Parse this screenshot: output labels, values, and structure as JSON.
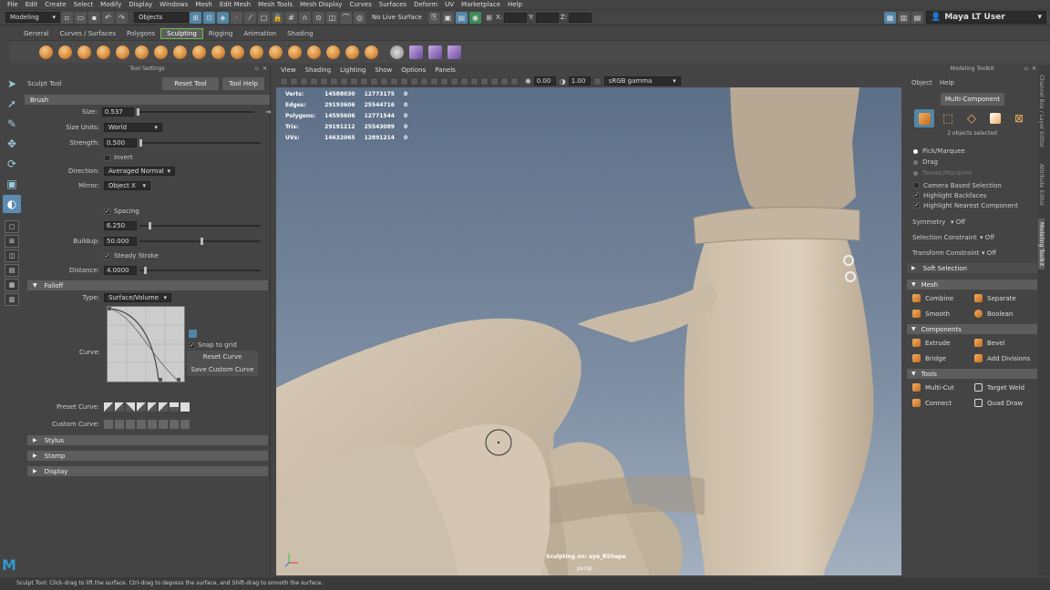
{
  "menubar": [
    "File",
    "Edit",
    "Create",
    "Select",
    "Modify",
    "Display",
    "Windows",
    "Mesh",
    "Edit Mesh",
    "Mesh Tools",
    "Mesh Display",
    "Curves",
    "Surfaces",
    "Deform",
    "UV",
    "Marketplace",
    "Help"
  ],
  "statusline": {
    "mode": "Modeling",
    "select_mode": "Objects",
    "live_surface": "No Live Surface",
    "x_label": "X:",
    "y_label": "Y:",
    "z_label": "Z:",
    "user": "Maya LT User"
  },
  "shelf": {
    "tabs": [
      "General",
      "Curves / Surfaces",
      "Polygons",
      "Sculpting",
      "Rigging",
      "Animation",
      "Shading"
    ],
    "active_tab": "Sculpting"
  },
  "tool_settings": {
    "header": "Tool Settings",
    "tool_name": "Sculpt Tool",
    "reset_tool": "Reset Tool",
    "tool_help": "Tool Help",
    "brush_section": "Brush",
    "size_label": "Size:",
    "size_value": "0.537",
    "size_units_label": "Size Units:",
    "size_units_value": "World",
    "strength_label": "Strength:",
    "strength_value": "0.500",
    "invert_label": "Invert",
    "direction_label": "Direction:",
    "direction_value": "Averaged Normal",
    "mirror_label": "Mirror:",
    "mirror_value": "Object X",
    "spacing_label": "Spacing",
    "spacing_value": "6.250",
    "buildup_label": "Buildup:",
    "buildup_value": "50.000",
    "steady_label": "Steady Stroke",
    "distance_label": "Distance:",
    "distance_value": "4.0000",
    "falloff_section": "Falloff",
    "type_label": "Type:",
    "type_value": "Surface/Volume",
    "curve_label": "Curve:",
    "snap_label": "Snap to grid",
    "reset_curve": "Reset Curve",
    "save_curve": "Save Custom Curve",
    "preset_curve_label": "Preset Curve:",
    "custom_curve_label": "Custom Curve:",
    "stylus_section": "Stylus",
    "stamp_section": "Stamp",
    "display_section": "Display"
  },
  "viewport": {
    "menu": [
      "View",
      "Shading",
      "Lighting",
      "Show",
      "Options",
      "Panels"
    ],
    "exposure": "0.00",
    "gamma": "1.00",
    "color_space": "sRGB gamma",
    "hud": [
      {
        "label": "Verts:",
        "a": "14588030",
        "b": "12773175",
        "c": "0"
      },
      {
        "label": "Edges:",
        "a": "29193606",
        "b": "25544716",
        "c": "0"
      },
      {
        "label": "Polygons:",
        "a": "14595606",
        "b": "12771544",
        "c": "0"
      },
      {
        "label": "Tris:",
        "a": "29191212",
        "b": "25543089",
        "c": "0"
      },
      {
        "label": "UVs:",
        "a": "14632065",
        "b": "12891214",
        "c": "0"
      }
    ],
    "sculpt_on": "Sculpting on: eye_RShape",
    "camera": "persp"
  },
  "modeling_toolkit": {
    "header": "Modeling Toolkit",
    "menu": [
      "Object",
      "Help"
    ],
    "multi_component": "Multi-Component",
    "selected": "2 objects selected",
    "pick_marquee": "Pick/Marquee",
    "drag": "Drag",
    "tweak_marquee": "Tweak/Marquee",
    "camera_based": "Camera Based Selection",
    "highlight_backfaces": "Highlight Backfaces",
    "highlight_nearest": "Highlight Nearest Component",
    "symmetry_label": "Symmetry",
    "symmetry_value": "Off",
    "sel_constraint_label": "Selection Constraint",
    "sel_constraint_value": "Off",
    "xform_constraint_label": "Transform Constraint",
    "xform_constraint_value": "Off",
    "soft_selection": "Soft Selection",
    "mesh_section": "Mesh",
    "combine": "Combine",
    "separate": "Separate",
    "smooth": "Smooth",
    "boolean": "Boolean",
    "components_section": "Components",
    "extrude": "Extrude",
    "bevel": "Bevel",
    "bridge": "Bridge",
    "add_divisions": "Add Divisions",
    "tools_section": "Tools",
    "multi_cut": "Multi-Cut",
    "target_weld": "Target Weld",
    "connect": "Connect",
    "quad_draw": "Quad Draw"
  },
  "side_tabs": [
    "Channel Box / Layer Editor",
    "Attribute Editor",
    "Modeling Toolkit"
  ],
  "helpline": "Sculpt Tool: Click-drag to lift the surface. Ctrl-drag to depress the surface, and Shift-drag to smooth the surface."
}
